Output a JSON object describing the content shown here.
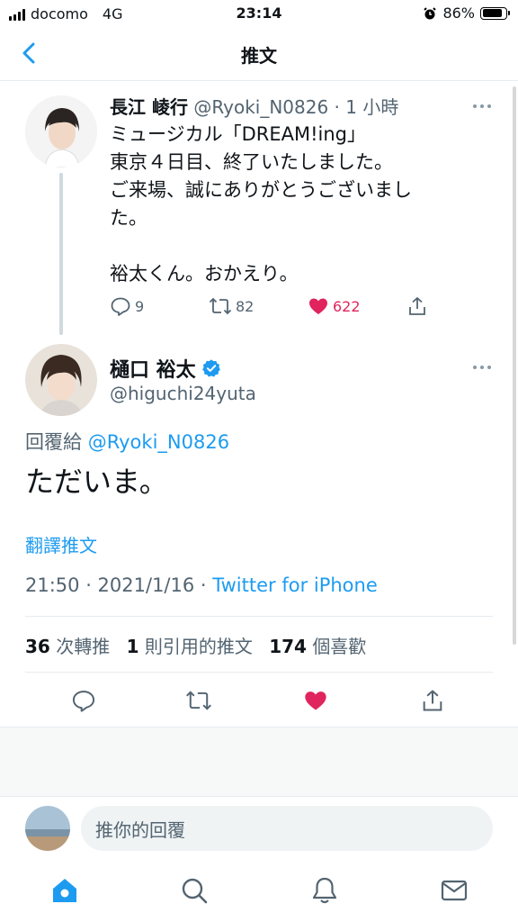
{
  "status_bar": {
    "carrier": "docomo",
    "network": "4G",
    "time": "23:14",
    "battery": "86%",
    "battery_level": 0.86
  },
  "nav": {
    "title": "推文"
  },
  "parent_tweet": {
    "name": "長江 崚行",
    "handle_time": "@Ryoki_N0826 · 1 小時",
    "lines": [
      "ミュージカル「DREAM!ing」",
      "東京４日目、終了いたしました。",
      "ご来場、誠にありがとうございまし",
      "た。",
      "裕太くん。おかえり。"
    ],
    "replies": "9",
    "retweets": "82",
    "likes": "622"
  },
  "main_tweet": {
    "name": "樋口 裕太",
    "handle": "@higuchi24yuta",
    "reply_prefix": "回覆給",
    "reply_handle": "@Ryoki_N0826",
    "text": "ただいま。",
    "translate": "翻譯推文",
    "time": "21:50 · 2021/1/16 ·",
    "source": "Twitter for iPhone",
    "stats": {
      "retweets": "36",
      "retweets_label": "次轉推",
      "quotes": "1",
      "quotes_label": "則引用的推文",
      "likes": "174",
      "likes_label": "個喜歡"
    }
  },
  "reply_bar": {
    "placeholder": "推你的回覆"
  },
  "colors": {
    "accent": "#1d9bf0",
    "like": "#e0245e",
    "verified": "#1d9bf0"
  },
  "icons": [
    "chevron-left-icon",
    "more-icon",
    "reply-icon",
    "retweet-icon",
    "heart-icon",
    "share-icon",
    "verified-icon",
    "home-icon",
    "search-icon",
    "bell-icon",
    "mail-icon"
  ]
}
